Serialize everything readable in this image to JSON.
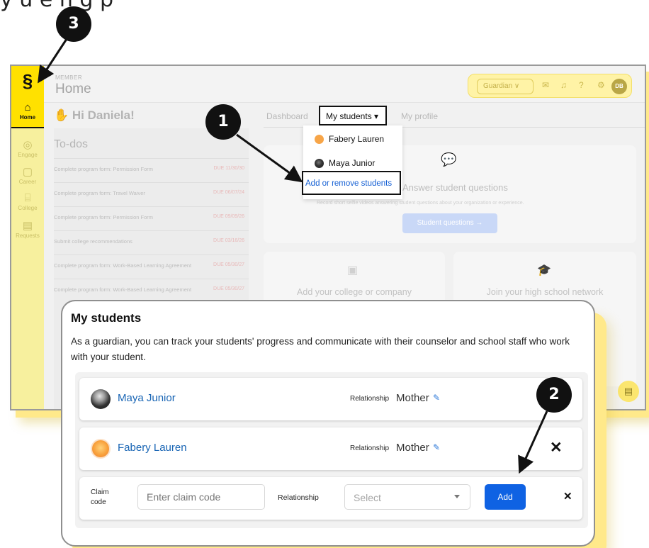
{
  "caption": "y    u  e     n  g  p",
  "app": {
    "eyebrow": "MEMBER",
    "page_title": "Home",
    "greeting": "Hi Daniela!",
    "header": {
      "role_select": "Guardian ∨",
      "avatar_initials": "DB"
    },
    "sidebar": {
      "items": [
        {
          "label": "Home",
          "icon": "house-icon"
        },
        {
          "label": "Engage",
          "icon": "handshake-icon"
        },
        {
          "label": "Career",
          "icon": "briefcase-icon"
        },
        {
          "label": "College",
          "icon": "bank-icon"
        },
        {
          "label": "Requests",
          "icon": "inbox-icon"
        }
      ]
    },
    "todos": {
      "title": "To-dos",
      "items": [
        {
          "text": "Complete program form: Permission Form",
          "due": "DUE 11/30/30"
        },
        {
          "text": "Complete program form: Travel Waiver",
          "due": "DUE 06/07/24"
        },
        {
          "text": "Complete program form: Permission Form",
          "due": "DUE 09/09/26"
        },
        {
          "text": "Submit college recommendations",
          "due": "DUE 03/16/26"
        },
        {
          "text": "Complete program form: Work-Based Learning Agreement",
          "due": "DUE 05/30/27"
        },
        {
          "text": "Complete program form: Work-Based Learning Agreement",
          "due": "DUE 05/30/27"
        }
      ]
    },
    "tabs": {
      "dashboard": "Dashboard",
      "my_students": "My students ▾",
      "my_profile": "My profile"
    },
    "dropdown": {
      "students": [
        "Fabery Lauren",
        "Maya Junior"
      ],
      "add_remove": "Add or remove students"
    },
    "cards": {
      "questions_title": "Answer student questions",
      "questions_sub": "Record short selfie videos answering student questions about your organization or experience.",
      "questions_button": "Student questions →",
      "college_title": "Add your college or company",
      "network_title": "Join your high school network"
    }
  },
  "panel": {
    "title": "My students",
    "description": "As a guardian, you can track your students' progress and communicate with their counselor and school staff who work with your student.",
    "students": [
      {
        "name": "Maya Junior",
        "relationship_label": "Relationship",
        "relationship": "Mother"
      },
      {
        "name": "Fabery Lauren",
        "relationship_label": "Relationship",
        "relationship": "Mother"
      }
    ],
    "add_row": {
      "claim_label": "Claim code",
      "claim_placeholder": "Enter claim code",
      "relationship_label": "Relationship",
      "select_value": "Select",
      "add_button": "Add"
    }
  },
  "markers": [
    "1",
    "2",
    "3"
  ],
  "colors": {
    "accent_yellow": "#ffe100",
    "link_blue": "#1764b4",
    "button_blue": "#0f62e3",
    "marker": "#111111"
  }
}
